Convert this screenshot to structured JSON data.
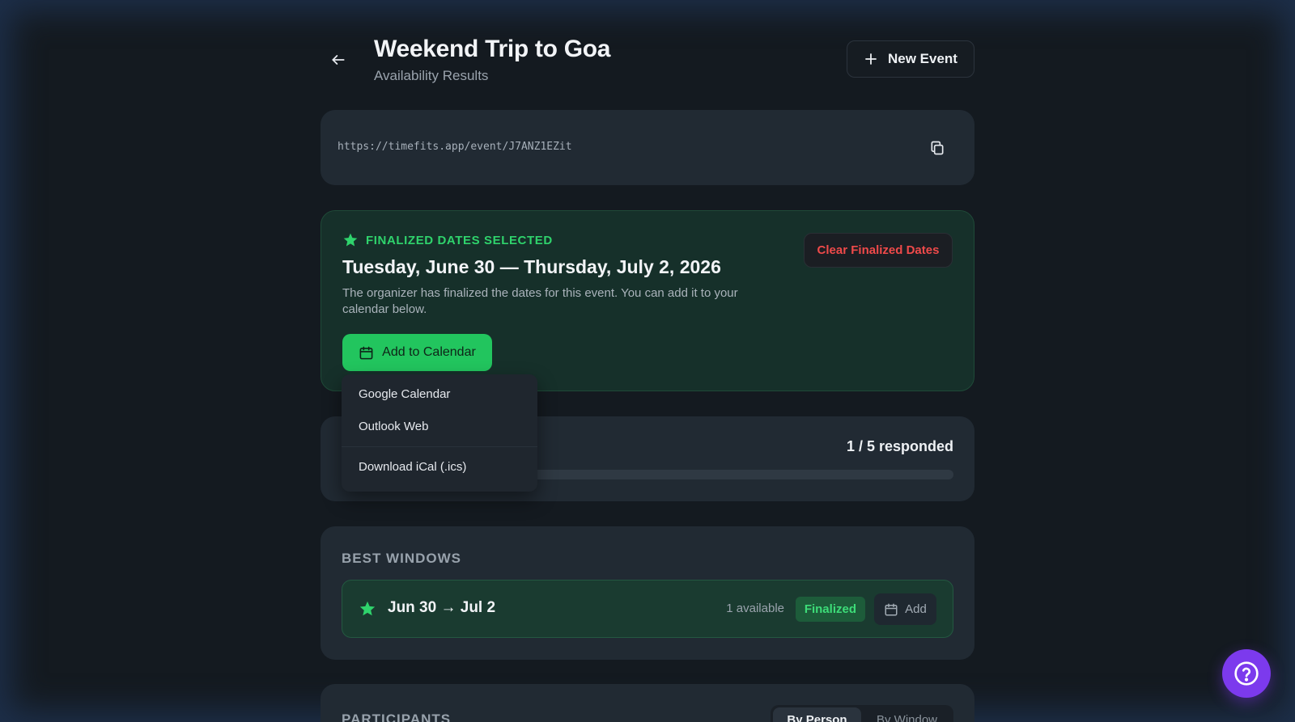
{
  "header": {
    "title": "Weekend Trip to Goa",
    "subtitle": "Availability Results",
    "new_event_label": "New Event"
  },
  "share": {
    "url": "https://timefits.app/event/J7ANZ1EZit"
  },
  "finalized": {
    "badge": "FINALIZED DATES SELECTED",
    "dates": "Tuesday, June 30 — Thursday, July 2, 2026",
    "description": "The organizer has finalized the dates for this event. You can add it to your calendar below.",
    "clear_label": "Clear Finalized Dates",
    "add_to_calendar_label": "Add to Calendar"
  },
  "calendar_menu": {
    "items": [
      "Google Calendar",
      "Outlook Web",
      "Download iCal (.ics)"
    ]
  },
  "responses": {
    "count_text": "1 / 5 responded",
    "progress_fraction": 0.2
  },
  "best_windows": {
    "title": "BEST WINDOWS",
    "windows": [
      {
        "label": "Jun 30 → Jul 2",
        "available": "1 available",
        "status": "Finalized",
        "add_label": "Add"
      }
    ]
  },
  "participants": {
    "title": "PARTICIPANTS",
    "views": [
      "By Person",
      "By Window"
    ],
    "active_view": "By Person"
  },
  "colors": {
    "background": "#141a20",
    "card": "#212a33",
    "accent_green": "#22c55e",
    "danger_red": "#ef4a4a",
    "help_purple": "#7c3aed"
  }
}
